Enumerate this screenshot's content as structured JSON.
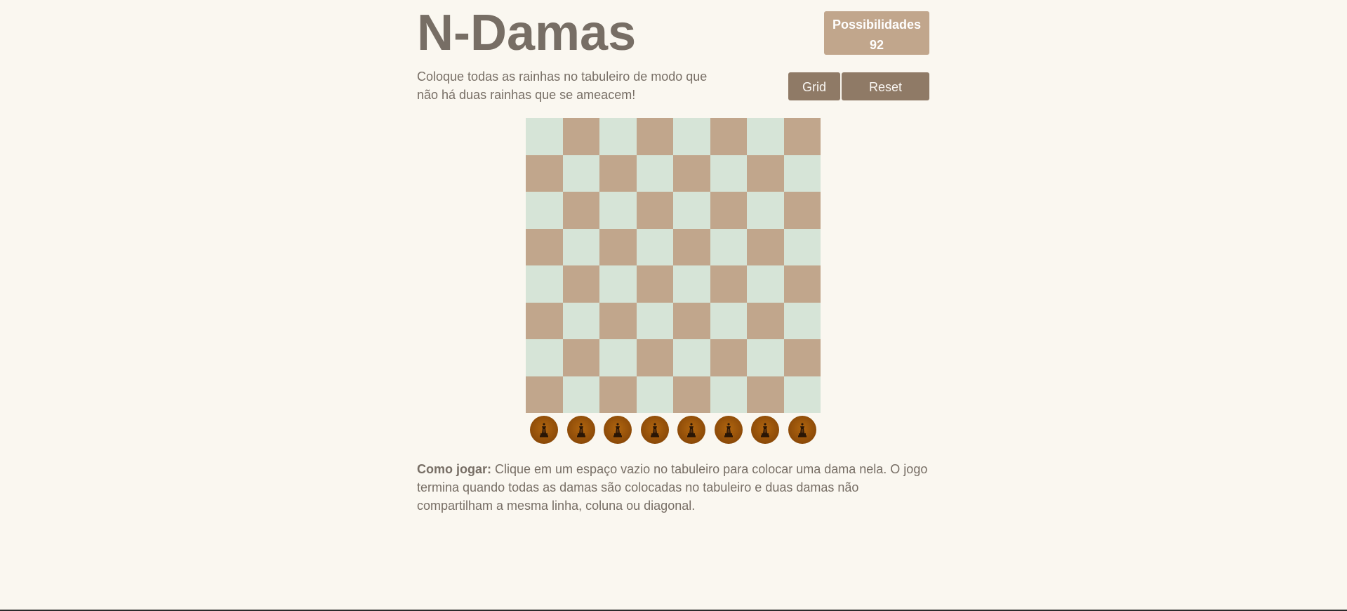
{
  "header": {
    "title": "N-Damas",
    "intro": "Coloque todas as rainhas no tabuleiro de modo que não há duas rainhas que se ameacem!"
  },
  "score": {
    "label": "Possibilidades",
    "value": "92"
  },
  "controls": {
    "grid_label": "Grid",
    "reset_label": "Reset"
  },
  "board": {
    "size": 8,
    "light_color": "#d6e4d7",
    "dark_color": "#c1a68c",
    "placed_queens": 0
  },
  "tray": {
    "queens_available": 8,
    "piece_icon": "queen-icon",
    "piece_color": "#8c4a08"
  },
  "instructions": {
    "label": "Como jogar:",
    "text": " Clique em um espaço vazio no tabuleiro para colocar uma dama nela. O jogo termina quando todas as damas são colocadas no tabuleiro e duas damas não compartilham a mesma linha, coluna ou diagonal."
  }
}
